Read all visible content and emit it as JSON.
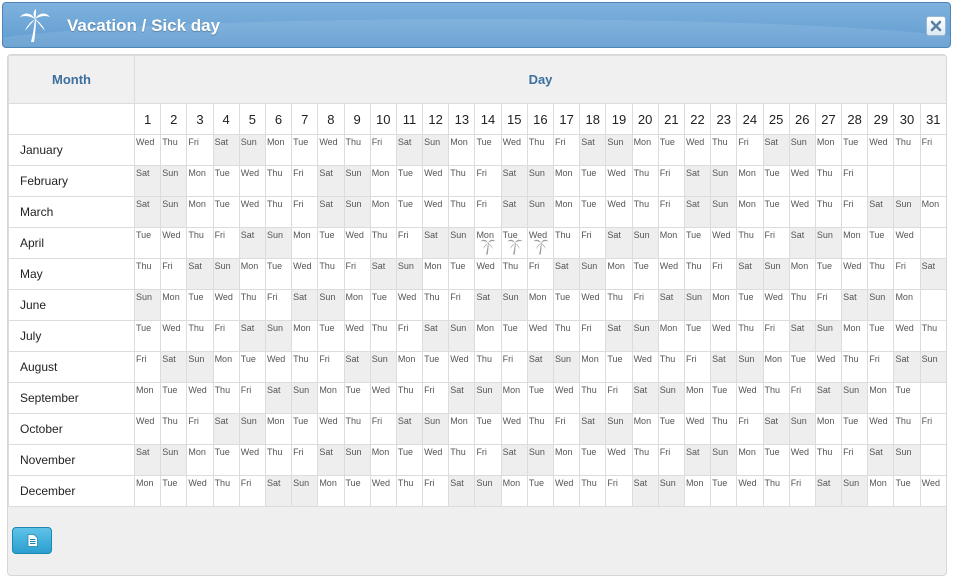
{
  "window": {
    "title": "Vacation / Sick day",
    "title_icon": "palm-tree-icon",
    "close_icon": "close-icon"
  },
  "table": {
    "month_header": "Month",
    "day_header": "Day",
    "day_numbers": [
      1,
      2,
      3,
      4,
      5,
      6,
      7,
      8,
      9,
      10,
      11,
      12,
      13,
      14,
      15,
      16,
      17,
      18,
      19,
      20,
      21,
      22,
      23,
      24,
      25,
      26,
      27,
      28,
      29,
      30,
      31
    ],
    "weekday_abbr": [
      "Sun",
      "Mon",
      "Tue",
      "Wed",
      "Thu",
      "Fri",
      "Sat"
    ],
    "months": [
      {
        "name": "January",
        "first_weekday": 3,
        "days": 31
      },
      {
        "name": "February",
        "first_weekday": 6,
        "days": 28
      },
      {
        "name": "March",
        "first_weekday": 6,
        "days": 31
      },
      {
        "name": "April",
        "first_weekday": 2,
        "days": 30
      },
      {
        "name": "May",
        "first_weekday": 4,
        "days": 31
      },
      {
        "name": "June",
        "first_weekday": 0,
        "days": 30
      },
      {
        "name": "July",
        "first_weekday": 2,
        "days": 31
      },
      {
        "name": "August",
        "first_weekday": 5,
        "days": 31
      },
      {
        "name": "September",
        "first_weekday": 1,
        "days": 30
      },
      {
        "name": "October",
        "first_weekday": 3,
        "days": 31
      },
      {
        "name": "November",
        "first_weekday": 6,
        "days": 30
      },
      {
        "name": "December",
        "first_weekday": 1,
        "days": 31
      }
    ],
    "vacation_days": [
      {
        "month": "April",
        "day": 14
      },
      {
        "month": "April",
        "day": 15
      },
      {
        "month": "April",
        "day": 16
      }
    ],
    "vacation_icon": "palm-tree-icon"
  },
  "footer": {
    "report_button_icon": "document-icon"
  },
  "colors": {
    "titlebar": "#6ea7d8",
    "header_text": "#3c6e9e",
    "weekend_cell": "#eeeeee",
    "button": "#3bb0dd"
  }
}
